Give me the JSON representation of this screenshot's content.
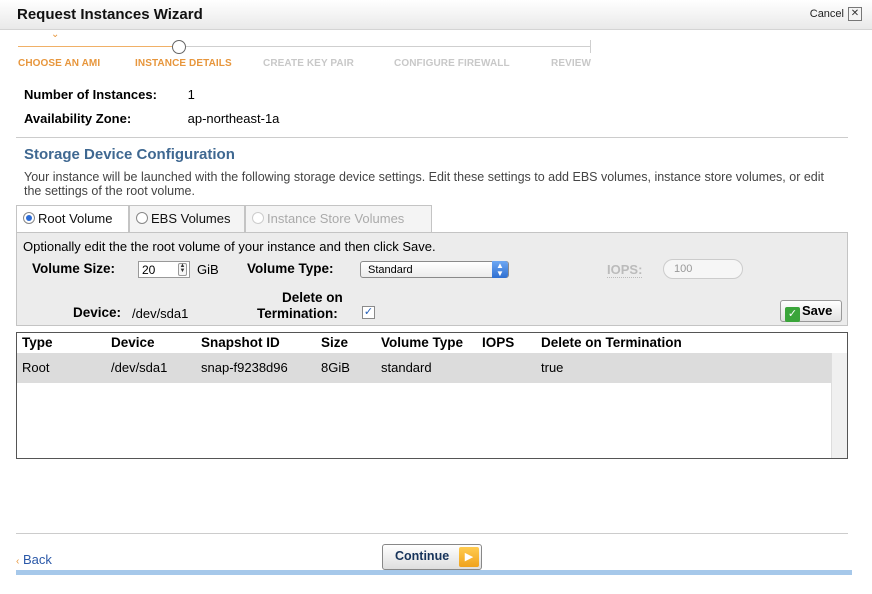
{
  "window": {
    "title": "Request Instances Wizard",
    "cancel_label": "Cancel",
    "close_glyph": "✕"
  },
  "steps": [
    {
      "label": "CHOOSE AN AMI",
      "state": "done"
    },
    {
      "label": "INSTANCE DETAILS",
      "state": "current"
    },
    {
      "label": "CREATE KEY PAIR",
      "state": "todo"
    },
    {
      "label": "CONFIGURE FIREWALL",
      "state": "todo"
    },
    {
      "label": "REVIEW",
      "state": "todo"
    }
  ],
  "instance": {
    "count_label": "Number of Instances:",
    "count_value": "1",
    "zone_label": "Availability Zone:",
    "zone_value": "ap-northeast-1a"
  },
  "storage": {
    "title": "Storage Device Configuration",
    "description": "Your instance will be launched with the following storage device settings. Edit these settings to add EBS volumes, instance store volumes, or edit the settings of the root volume.",
    "tabs": [
      {
        "label": "Root Volume",
        "selected": true,
        "enabled": true
      },
      {
        "label": "EBS Volumes",
        "selected": false,
        "enabled": true
      },
      {
        "label": "Instance Store Volumes",
        "selected": false,
        "enabled": false
      }
    ],
    "hint": "Optionally edit the the root volume of your instance and then click Save.",
    "volume_size_label": "Volume Size:",
    "volume_size_value": "20",
    "volume_size_unit": "GiB",
    "volume_type_label": "Volume Type:",
    "volume_type_value": "Standard",
    "iops_label": "IOPS:",
    "iops_placeholder": "100",
    "device_label": "Device:",
    "device_value": "/dev/sda1",
    "delete_label_line1": "Delete on",
    "delete_label_line2": "Termination:",
    "delete_checked": true,
    "save_label": "Save"
  },
  "table": {
    "columns": [
      "Type",
      "Device",
      "Snapshot ID",
      "Size",
      "Volume Type",
      "IOPS",
      "Delete on Termination"
    ],
    "rows": [
      {
        "type": "Root",
        "device": "/dev/sda1",
        "snapshot": "snap-f9238d96",
        "size": "8GiB",
        "volume_type": "standard",
        "iops": "",
        "delete": "true"
      }
    ]
  },
  "footer": {
    "back_label": "Back",
    "continue_label": "Continue"
  },
  "colors": {
    "accent_orange": "#e7963c",
    "section_blue": "#3f6891",
    "link_blue": "#2a58a8"
  }
}
